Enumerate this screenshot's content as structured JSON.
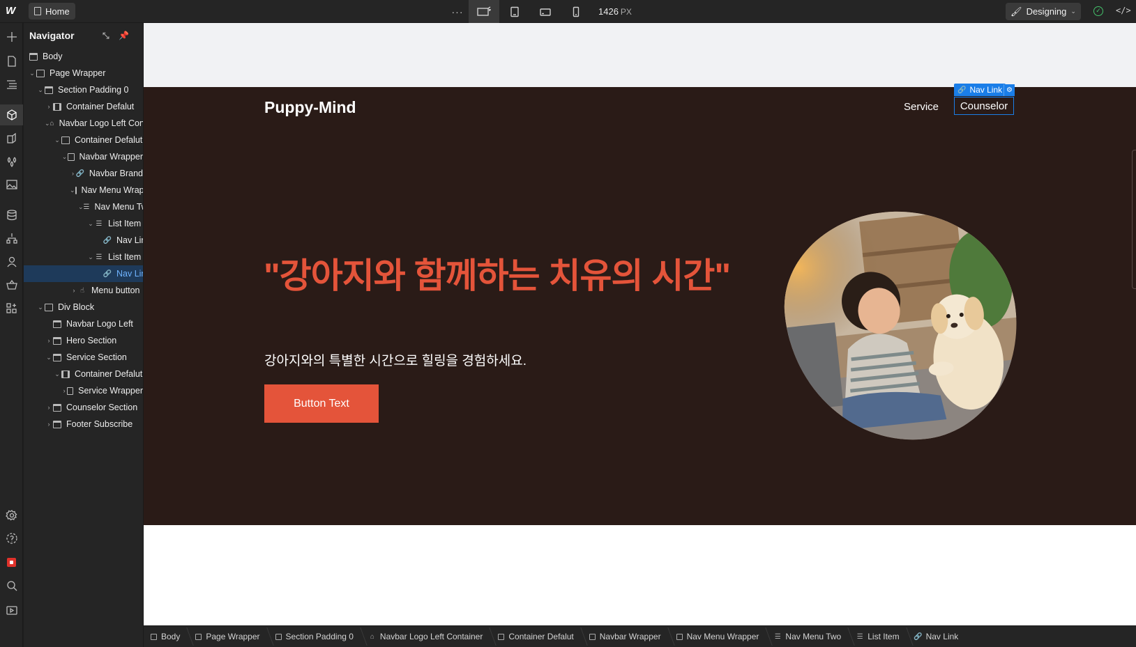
{
  "topbar": {
    "logo": "W",
    "page_name": "Home",
    "more": "···",
    "width_value": "1426",
    "width_unit": "PX",
    "mode_label": "Designing",
    "status": "✓",
    "code": "</>"
  },
  "navigator": {
    "title": "Navigator",
    "items": [
      {
        "label": "Body"
      },
      {
        "label": "Page Wrapper"
      },
      {
        "label": "Section Padding 0"
      },
      {
        "label": "Container Defalut"
      },
      {
        "label": "Navbar Logo Left Container"
      },
      {
        "label": "Container Defalut"
      },
      {
        "label": "Navbar Wrapper"
      },
      {
        "label": "Navbar Brand"
      },
      {
        "label": "Nav Menu Wrapper"
      },
      {
        "label": "Nav Menu Two"
      },
      {
        "label": "List Item"
      },
      {
        "label": "Nav Link"
      },
      {
        "label": "List Item"
      },
      {
        "label": "Nav Link"
      },
      {
        "label": "Menu button"
      },
      {
        "label": "Div Block"
      },
      {
        "label": "Navbar Logo Left"
      },
      {
        "label": "Hero Section"
      },
      {
        "label": "Service Section"
      },
      {
        "label": "Container Defalut"
      },
      {
        "label": "Service Wrapper"
      },
      {
        "label": "Counselor Section"
      },
      {
        "label": "Footer Subscribe"
      }
    ]
  },
  "canvas": {
    "brand": "Puppy-Mind",
    "nav_service": "Service",
    "nav_counselor": "Counselor",
    "selection_tag": "Nav Link",
    "hero_title": "\"강아지와 함께하는 치유의 시간\"",
    "hero_subtitle": "강아지와의 특별한 시간으로 힐링을 경험하세요.",
    "hero_button": "Button Text"
  },
  "breadcrumb": [
    {
      "label": "Body"
    },
    {
      "label": "Page Wrapper"
    },
    {
      "label": "Section Padding 0"
    },
    {
      "label": "Navbar Logo Left Container"
    },
    {
      "label": "Container Defalut"
    },
    {
      "label": "Navbar Wrapper"
    },
    {
      "label": "Nav Menu Wrapper"
    },
    {
      "label": "Nav Menu Two"
    },
    {
      "label": "List Item"
    },
    {
      "label": "Nav Link"
    }
  ],
  "colors": {
    "accent_blue": "#1a7ee8",
    "hero_background": "#2a1b17",
    "brand_orange": "#e4543a",
    "success_green": "#44c26b"
  }
}
